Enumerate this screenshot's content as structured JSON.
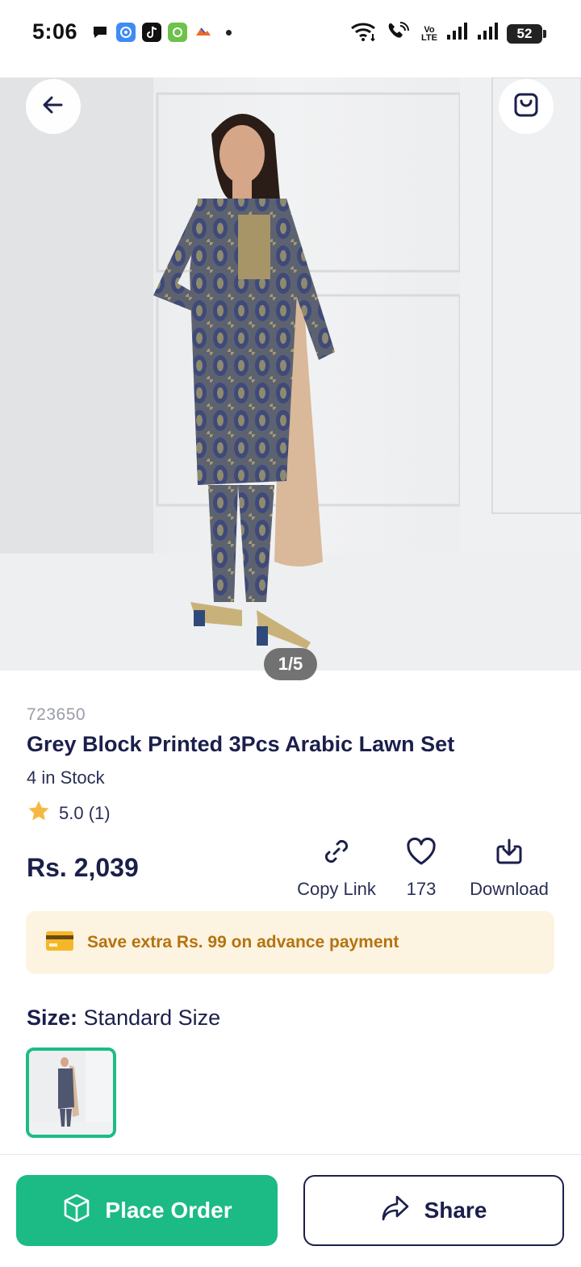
{
  "status_bar": {
    "time": "5:06",
    "volte_top": "Vo",
    "volte_bottom": "LTE",
    "battery": "52"
  },
  "hero": {
    "counter": "1/5",
    "back_icon": "arrow-left-icon",
    "bag_icon": "shopping-bag-icon"
  },
  "product": {
    "sku": "723650",
    "title": "Grey Block Printed 3Pcs Arabic Lawn Set",
    "stock": "4 in Stock",
    "rating": "5.0 (1)",
    "price": "Rs. 2,039"
  },
  "actions": {
    "copy_link": "Copy Link",
    "likes": "173",
    "download": "Download"
  },
  "promo": {
    "text": "Save extra Rs. 99 on advance payment"
  },
  "size": {
    "label": "Size:",
    "value": "Standard Size"
  },
  "bottom": {
    "place_order": "Place Order",
    "share": "Share"
  },
  "colors": {
    "primary_green": "#1cbb86",
    "navy_text": "#1b1f4b",
    "promo_bg": "#fdf3e1",
    "promo_text": "#b5730f",
    "star": "#f5b942"
  }
}
